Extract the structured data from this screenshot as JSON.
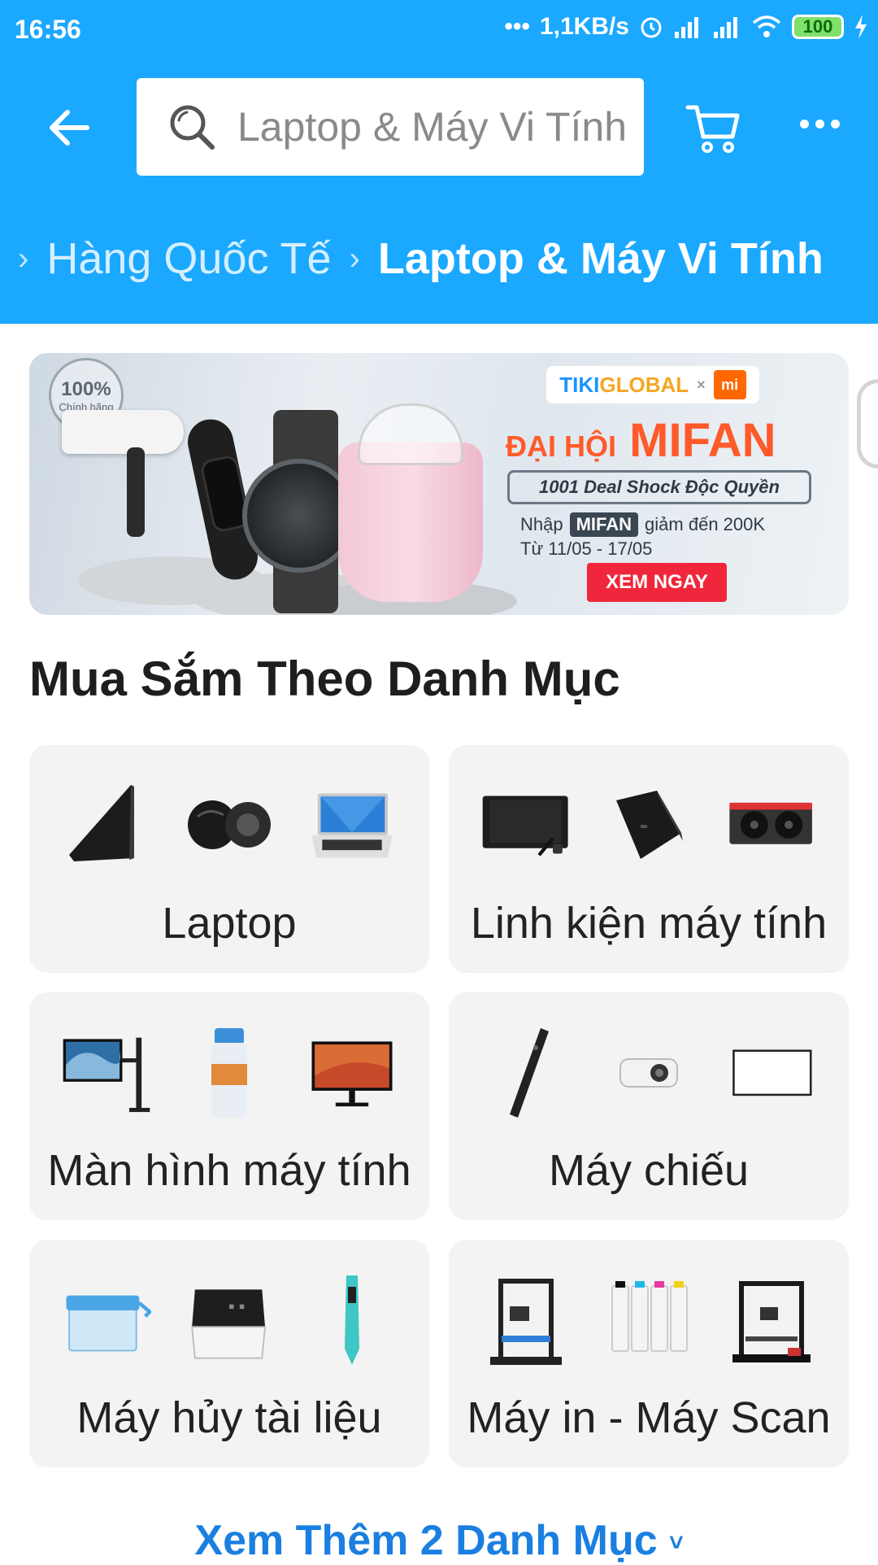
{
  "status_bar": {
    "time": "16:56",
    "net_speed": "1,1KB/s",
    "battery": "100"
  },
  "header": {
    "search_placeholder": "Laptop & Máy Vi Tính",
    "breadcrumb": [
      {
        "label": "Hàng Quốc Tế"
      },
      {
        "label": "Laptop & Máy Vi Tính"
      }
    ]
  },
  "banner": {
    "badge_big": "100%",
    "badge_small": "Chính hãng",
    "brand_tiki": "TIKI",
    "brand_global": "GLOBAL",
    "brand_x": "×",
    "brand_mi": "mi",
    "title_prefix": "ĐẠI HỘI",
    "title_main": "MIFAN",
    "deal_text": "1001 Deal Shock Độc Quyền",
    "promo_prefix": "Nhập",
    "promo_code": "MIFAN",
    "promo_suffix": "giảm đến 200K",
    "promo_dates": "Từ 11/05 - 17/05",
    "cta": "XEM NGAY"
  },
  "section": {
    "title": "Mua Sắm Theo Danh Mục"
  },
  "categories": [
    {
      "label": "Laptop"
    },
    {
      "label": "Linh kiện máy tính"
    },
    {
      "label": "Màn hình máy tính"
    },
    {
      "label": "Máy chiếu"
    },
    {
      "label": "Máy hủy tài liệu"
    },
    {
      "label": "Máy in - Máy Scan"
    }
  ],
  "see_more": {
    "label": "Xem Thêm 2 Danh Mục"
  },
  "colors": {
    "header_blue": "#1ba8ff",
    "link_blue": "#1a7fe0",
    "card_bg": "#f3f3f3",
    "cta_red": "#f0273c"
  }
}
